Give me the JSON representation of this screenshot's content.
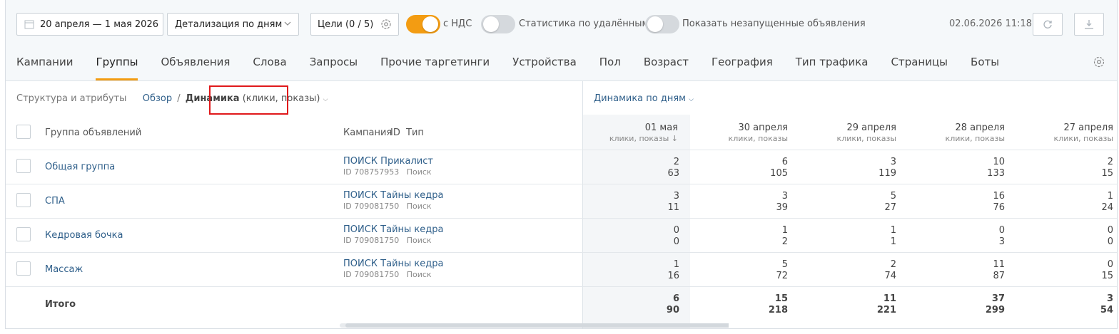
{
  "toolbar": {
    "date_range": "20 апреля — 1 мая 2026",
    "detail_select": "Детализация по дням",
    "goals": "Цели (0 / 5)",
    "vat_label": "с НДС",
    "vat_on": true,
    "deleted_stats_label": "Статистика по удалённым",
    "deleted_stats_on": false,
    "show_not_launched_label": "Показать незапущенные объявления",
    "show_not_launched_on": false,
    "timestamp": "02.06.2026 11:18",
    "icons": [
      "calendar-icon",
      "chevron-down-icon",
      "gear-icon",
      "refresh-icon",
      "download-icon"
    ]
  },
  "tabs": [
    "Кампании",
    "Группы",
    "Объявления",
    "Слова",
    "Запросы",
    "Прочие таргетинги",
    "Устройства",
    "Пол",
    "Возраст",
    "География",
    "Тип трафика",
    "Страницы",
    "Боты"
  ],
  "active_tab": "Группы",
  "breadcrumb": {
    "structure": "Структура и атрибуты",
    "overview": "Обзор",
    "sep": "/",
    "dynamics": "Динамика",
    "metrics": "(клики, показы)"
  },
  "dynamics_title": "Динамика по дням",
  "table": {
    "col_group": "Группа объявлений",
    "col_campaign": "Кампания",
    "col_id": "ID",
    "col_type": "Тип",
    "days": [
      {
        "date": "01 мая",
        "sub": "клики, показы",
        "sorted": true
      },
      {
        "date": "30 апреля",
        "sub": "клики, показы"
      },
      {
        "date": "29 апреля",
        "sub": "клики, показы"
      },
      {
        "date": "28 апреля",
        "sub": "клики, показы"
      },
      {
        "date": "27 апреля",
        "sub": "клики, показы"
      }
    ],
    "rows": [
      {
        "group": "Общая группа",
        "campaign": "ПОИСК Прикалист",
        "meta": "ID 708757953   Поиск",
        "clicks": [
          "2",
          "6",
          "3",
          "10",
          "2"
        ],
        "shows": [
          "63",
          "105",
          "119",
          "133",
          "15"
        ]
      },
      {
        "group": "СПА",
        "campaign": "ПОИСК Тайны кедра",
        "meta": "ID 709081750   Поиск",
        "clicks": [
          "3",
          "3",
          "5",
          "16",
          "1"
        ],
        "shows": [
          "11",
          "39",
          "27",
          "76",
          "24"
        ]
      },
      {
        "group": "Кедровая бочка",
        "campaign": "ПОИСК Тайны кедра",
        "meta": "ID 709081750   Поиск",
        "clicks": [
          "0",
          "1",
          "1",
          "0",
          "0"
        ],
        "shows": [
          "0",
          "2",
          "1",
          "3",
          "0"
        ]
      },
      {
        "group": "Массаж",
        "campaign": "ПОИСК Тайны кедра",
        "meta": "ID 709081750   Поиск",
        "clicks": [
          "1",
          "5",
          "2",
          "11",
          "0"
        ],
        "shows": [
          "16",
          "72",
          "74",
          "87",
          "15"
        ]
      }
    ],
    "total": {
      "label": "Итого",
      "clicks": [
        "6",
        "15",
        "11",
        "37",
        "3"
      ],
      "shows": [
        "90",
        "218",
        "221",
        "299",
        "54"
      ]
    }
  }
}
